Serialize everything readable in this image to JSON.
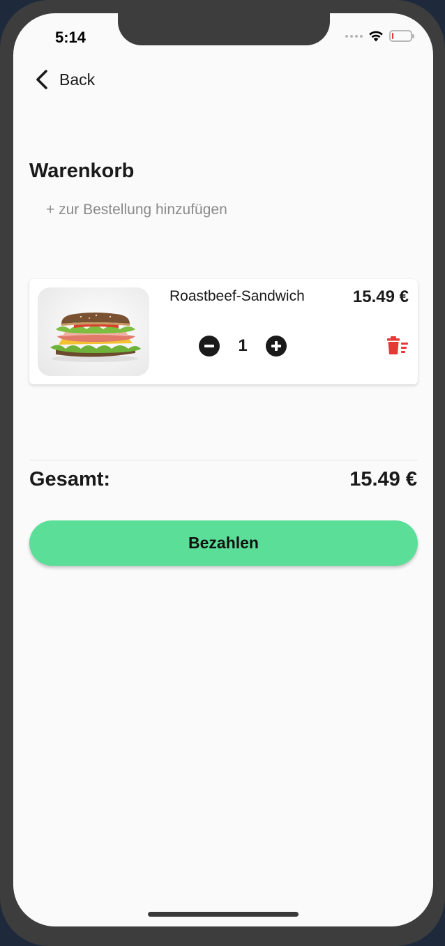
{
  "status_bar": {
    "time": "5:14",
    "signal_icon": "signal-dots-icon",
    "wifi_icon": "wifi-icon",
    "battery_icon": "battery-icon",
    "battery_level": 0.05,
    "battery_color": "#e53935"
  },
  "nav": {
    "back_icon": "chevron-left-icon",
    "back_label": "Back"
  },
  "page": {
    "title": "Warenkorb",
    "add_link": "+ zur Bestellung hinzufügen"
  },
  "cart": {
    "items": [
      {
        "image": "sandwich-photo",
        "name": "Roastbeef-Sandwich",
        "price": "15.49 €",
        "quantity": "1",
        "decrement_icon": "minus-circle-icon",
        "increment_icon": "plus-circle-icon",
        "delete_icon": "trash-icon",
        "delete_color": "#e53935"
      }
    ]
  },
  "summary": {
    "total_label": "Gesamt:",
    "total_value": "15.49 €"
  },
  "actions": {
    "pay_label": "Bezahlen",
    "pay_color": "#5bde98"
  }
}
